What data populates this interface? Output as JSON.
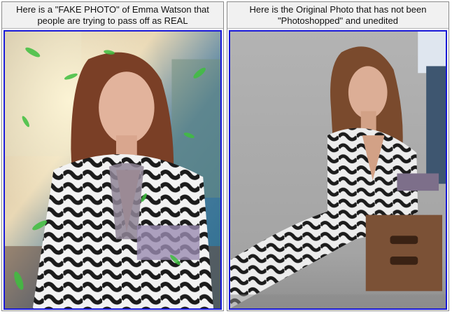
{
  "left_panel": {
    "caption_line1": "Here is a \"FAKE PHOTO\" of Emma Watson that",
    "caption_line2": "people are trying to pass off as REAL"
  },
  "right_panel": {
    "caption_line1": "Here is the Original Photo that has not been",
    "caption_line2": "\"Photoshopped\" and unedited"
  },
  "colors": {
    "frame_border": "#1a1ad8",
    "caption_bg": "#f1f1f1"
  }
}
